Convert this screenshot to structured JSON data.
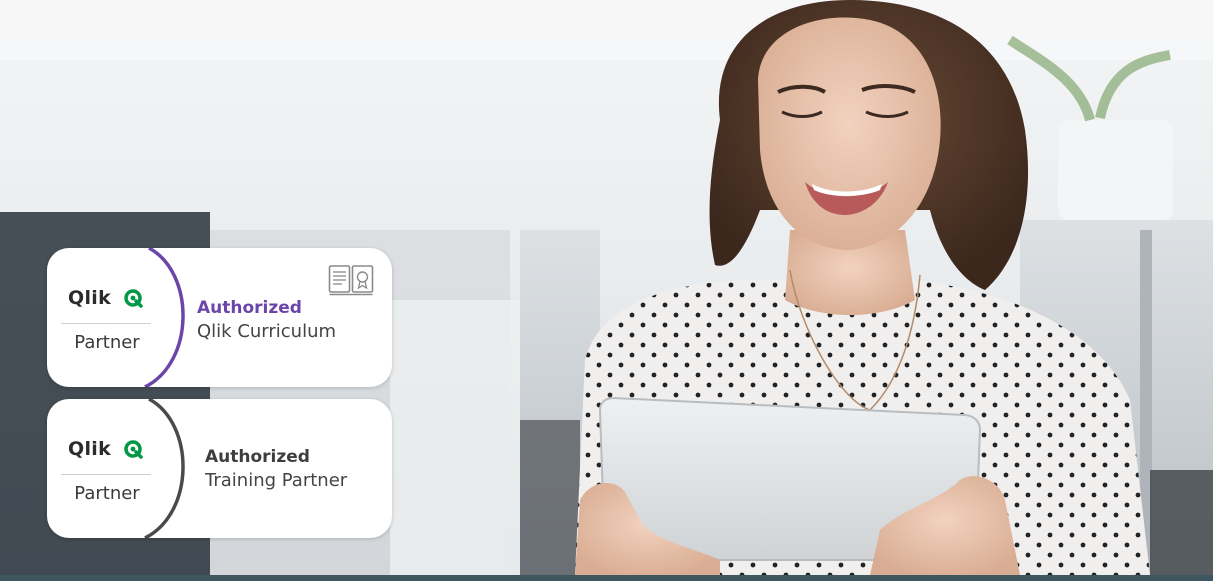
{
  "badges": [
    {
      "logo_text": "Qlik",
      "partner_label": "Partner",
      "title": "Authorized",
      "subtitle": "Qlik Curriculum",
      "accent_color": "#6b45a8",
      "icon": "certificate-book-icon"
    },
    {
      "logo_text": "Qlik",
      "partner_label": "Partner",
      "title": "Authorized",
      "subtitle": "Training Partner",
      "accent_color": "#4a4a4a"
    }
  ],
  "colors": {
    "qlik_green": "#009845",
    "bottom_bar": "#3f5560"
  }
}
